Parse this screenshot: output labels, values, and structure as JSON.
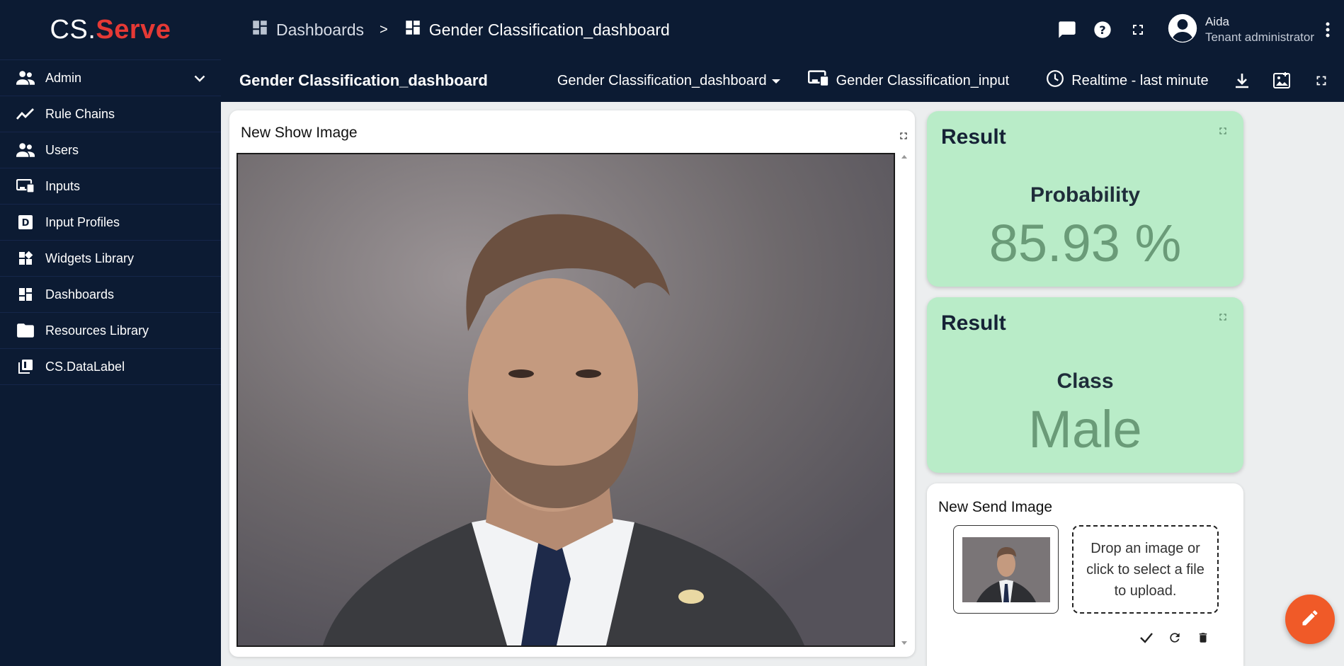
{
  "logo": {
    "part1": "CS.",
    "part2": "Serve"
  },
  "breadcrumb": {
    "items": [
      {
        "label": "Dashboards",
        "icon": "dashboard-icon"
      },
      {
        "label": "Gender Classification_dashboard",
        "icon": "dashboard-icon"
      }
    ],
    "separator": ">"
  },
  "header_icons": [
    "chat-icon",
    "help-icon",
    "fullscreen-icon"
  ],
  "user": {
    "name": "Aida",
    "role": "Tenant administrator",
    "icon": "account-circle-icon"
  },
  "sidebar": {
    "items": [
      {
        "label": "Admin",
        "icon": "people-icon",
        "expandable": true
      },
      {
        "label": "Rule Chains",
        "icon": "trending-line-icon"
      },
      {
        "label": "Users",
        "icon": "people-icon"
      },
      {
        "label": "Inputs",
        "icon": "devices-icon"
      },
      {
        "label": "Input Profiles",
        "icon": "profile-d-icon"
      },
      {
        "label": "Widgets Library",
        "icon": "widgets-icon"
      },
      {
        "label": "Dashboards",
        "icon": "dashboard-icon"
      },
      {
        "label": "Resources Library",
        "icon": "folder-icon"
      },
      {
        "label": "CS.DataLabel",
        "icon": "library-icon"
      }
    ]
  },
  "dashboard_toolbar": {
    "title": "Gender Classification_dashboard",
    "state_select": "Gender Classification_dashboard",
    "entity_alias": "Gender Classification_input",
    "timewindow": "Realtime - last minute",
    "actions": [
      "download-icon",
      "export-image-icon",
      "fullscreen-icon"
    ]
  },
  "widgets": {
    "show_image": {
      "title": "New Show Image"
    },
    "result_probability": {
      "title": "Result",
      "label": "Probability",
      "value": "85.93 %"
    },
    "result_class": {
      "title": "Result",
      "label": "Class",
      "value": "Male"
    },
    "send_image": {
      "title": "New Send Image",
      "drop_text": "Drop an image or click to select a file to upload.",
      "actions": [
        "check-icon",
        "refresh-icon",
        "delete-icon"
      ]
    }
  },
  "colors": {
    "navy": "#0c1b33",
    "accent_red": "#e53935",
    "result_bg": "#b9ecc8",
    "result_value": "#6a9b78",
    "fab": "#f05a28"
  },
  "fab": {
    "icon": "edit-pencil-icon"
  }
}
